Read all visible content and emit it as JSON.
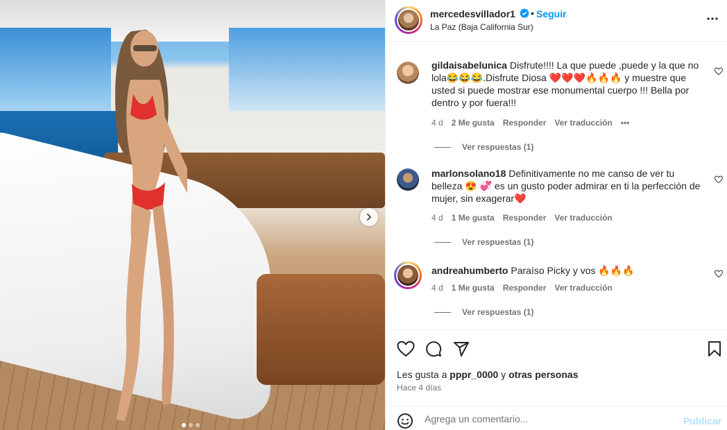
{
  "post": {
    "username": "mercedesvillador1",
    "verified": true,
    "follow_label": "Seguir",
    "separator": "•",
    "location": "La Paz (Baja California Sur)",
    "photo_count": 3,
    "active_photo_index": 0
  },
  "comments": [
    {
      "username": "gildaisabelunica",
      "text": " Disfrute!!!! La que puede ,puede y la que no lola😂😂😂.Disfrute Diosa ❤️❤️❤️🔥🔥🔥 y muestre que usted si puede mostrar ese monumental cuerpo !!! Bella por dentro y por fuera!!!",
      "age": "4 d",
      "likes": "2 Me gusta",
      "reply_label": "Responder",
      "translate_label": "Ver traducción",
      "more_icon": "•••",
      "view_replies": "Ver respuestas (1)"
    },
    {
      "username": "marlonsolano18",
      "text": " Definitivamente no me canso de ver tu belleza 😍 💞 es un gusto poder admirar en ti la perfección de mujer, sin exagerar❤️",
      "age": "4 d",
      "likes": "1 Me gusta",
      "reply_label": "Responder",
      "translate_label": "Ver traducción",
      "view_replies": "Ver respuestas (1)"
    },
    {
      "username": "andreahumberto",
      "text": " Paraíso Picky y vos 🔥🔥🔥",
      "age": "4 d",
      "likes": "1 Me gusta",
      "reply_label": "Responder",
      "translate_label": "Ver traducción",
      "view_replies": "Ver respuestas (1)"
    }
  ],
  "likes_summary": {
    "prefix": "Les gusta a ",
    "user": "pppr_0000",
    "middle": " y ",
    "others": "otras personas"
  },
  "posted_ago": "Hace 4 días",
  "composer": {
    "placeholder": "Agrega un comentario...",
    "publish_label": "Publicar"
  },
  "colors": {
    "accent": "#0095f6",
    "publish_disabled": "#b2dffc",
    "muted": "#737373",
    "text": "#262626"
  },
  "icons": {
    "verified": "verified-badge-icon",
    "more": "more-options-icon",
    "like": "heart-icon",
    "comment": "comment-icon",
    "share": "paper-plane-icon",
    "save": "bookmark-icon",
    "emoji": "emoji-icon",
    "next": "chevron-right-icon"
  }
}
